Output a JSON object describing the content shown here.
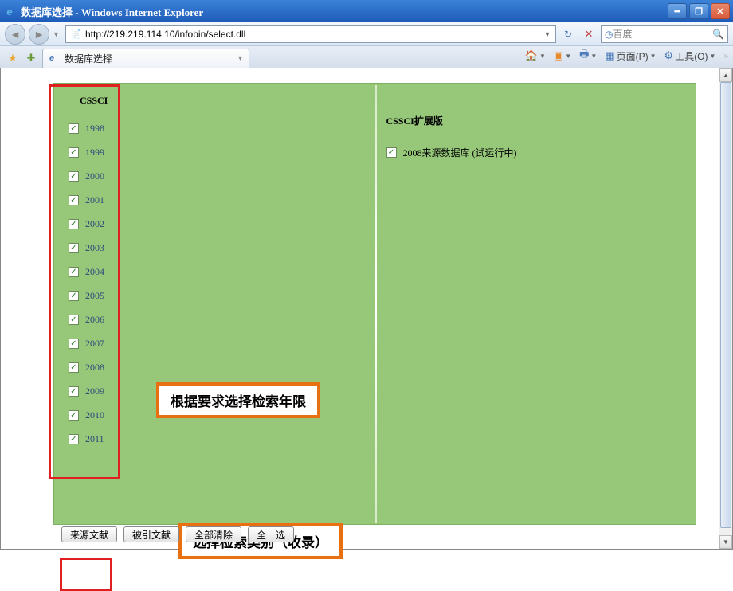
{
  "window": {
    "title": "数据库选择 - Windows Internet Explorer"
  },
  "address": {
    "url": "http://219.219.114.10/infobin/select.dll"
  },
  "search": {
    "placeholder": "百度"
  },
  "tab": {
    "title": "数据库选择"
  },
  "toolbar": {
    "page": "页面(P)",
    "tools": "工具(O)"
  },
  "page": {
    "left_title": "CSSCI",
    "right_title": "CSSCI扩展版",
    "years": [
      "1998",
      "1999",
      "2000",
      "2001",
      "2002",
      "2003",
      "2004",
      "2005",
      "2006",
      "2007",
      "2008",
      "2009",
      "2010",
      "2011"
    ],
    "ext_item": "2008来源数据库 (试运行中)"
  },
  "buttons": {
    "src": "来源文献",
    "cited": "被引文献",
    "clear": "全部清除",
    "all": "全　选"
  },
  "annotations": {
    "callout1": "根据要求选择检索年限",
    "callout2": "选择检索类别（收录）"
  }
}
